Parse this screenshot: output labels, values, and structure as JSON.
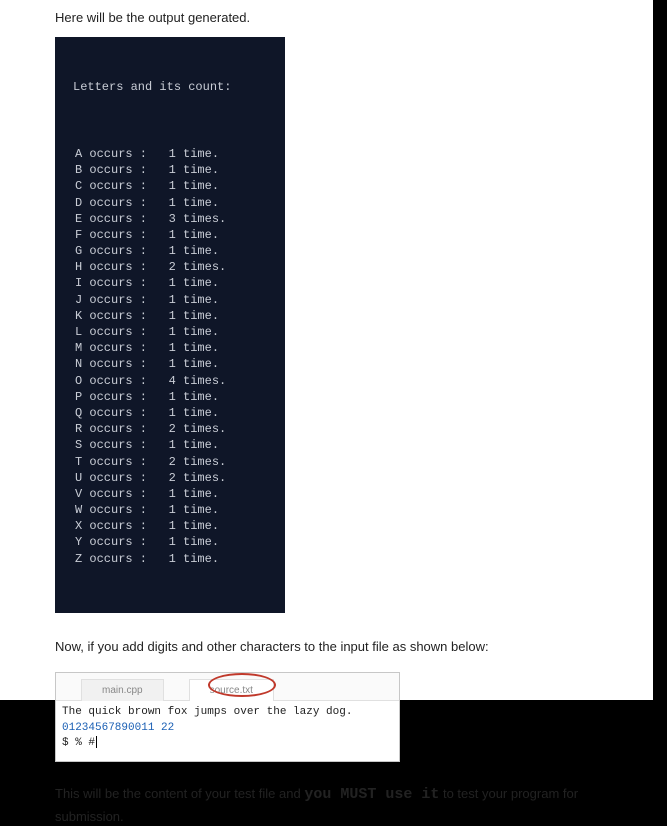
{
  "intro": "Here will be the output generated.",
  "terminal": {
    "header": "Letters and its count:",
    "rows": [
      {
        "letter": "A",
        "count": 1,
        "word": "time."
      },
      {
        "letter": "B",
        "count": 1,
        "word": "time."
      },
      {
        "letter": "C",
        "count": 1,
        "word": "time."
      },
      {
        "letter": "D",
        "count": 1,
        "word": "time."
      },
      {
        "letter": "E",
        "count": 3,
        "word": "times."
      },
      {
        "letter": "F",
        "count": 1,
        "word": "time."
      },
      {
        "letter": "G",
        "count": 1,
        "word": "time."
      },
      {
        "letter": "H",
        "count": 2,
        "word": "times."
      },
      {
        "letter": "I",
        "count": 1,
        "word": "time."
      },
      {
        "letter": "J",
        "count": 1,
        "word": "time."
      },
      {
        "letter": "K",
        "count": 1,
        "word": "time."
      },
      {
        "letter": "L",
        "count": 1,
        "word": "time."
      },
      {
        "letter": "M",
        "count": 1,
        "word": "time."
      },
      {
        "letter": "N",
        "count": 1,
        "word": "time."
      },
      {
        "letter": "O",
        "count": 4,
        "word": "times."
      },
      {
        "letter": "P",
        "count": 1,
        "word": "time."
      },
      {
        "letter": "Q",
        "count": 1,
        "word": "time."
      },
      {
        "letter": "R",
        "count": 2,
        "word": "times."
      },
      {
        "letter": "S",
        "count": 1,
        "word": "time."
      },
      {
        "letter": "T",
        "count": 2,
        "word": "times."
      },
      {
        "letter": "U",
        "count": 2,
        "word": "times."
      },
      {
        "letter": "V",
        "count": 1,
        "word": "time."
      },
      {
        "letter": "W",
        "count": 1,
        "word": "time."
      },
      {
        "letter": "X",
        "count": 1,
        "word": "time."
      },
      {
        "letter": "Y",
        "count": 1,
        "word": "time."
      },
      {
        "letter": "Z",
        "count": 1,
        "word": "time."
      }
    ]
  },
  "followText": "Now, if you add digits and other characters to the input file as shown below:",
  "editor": {
    "tabs": {
      "inactive": "main.cpp",
      "active": "source.txt"
    },
    "line1": "The quick brown fox jumps over the lazy dog.",
    "line2": "01234567890011 22",
    "line3": "$ % #"
  },
  "final": {
    "p1a": "This will be the content of your test file and ",
    "emph": "you MUST use it",
    "p1b": " to test your program for submission."
  }
}
